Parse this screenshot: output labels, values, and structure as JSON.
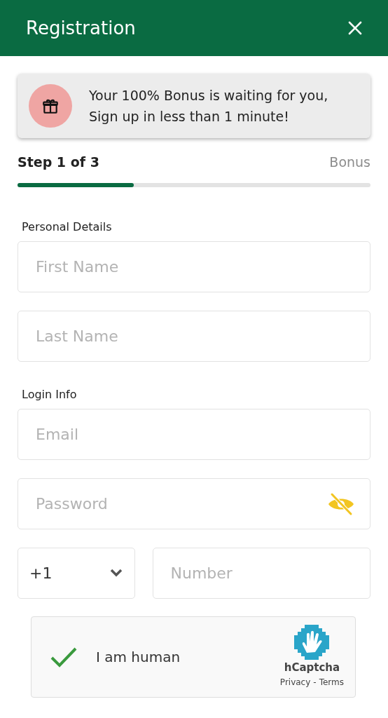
{
  "header": {
    "title": "Registration"
  },
  "banner": {
    "text": "Your 100% Bonus is waiting for you, Sign up in less than 1 minute!"
  },
  "progress": {
    "step": "Step 1 of 3",
    "next": "Bonus",
    "level": 0.33
  },
  "sections": [
    {
      "label": "Personal Details",
      "fields": [
        {
          "placeholder": "First Name"
        },
        {
          "placeholder": "Last Name"
        }
      ]
    },
    {
      "label": "Login Info",
      "fields": [
        {
          "placeholder": "Email"
        },
        {
          "placeholder": "Password",
          "kind": "password",
          "revealed": false
        }
      ]
    }
  ],
  "phone": {
    "code": "+1",
    "placeholder": "Number"
  },
  "captcha": {
    "checked": true,
    "label": "I am human",
    "brand": "hCaptcha",
    "links": [
      "Privacy",
      "-",
      "Terms"
    ]
  }
}
